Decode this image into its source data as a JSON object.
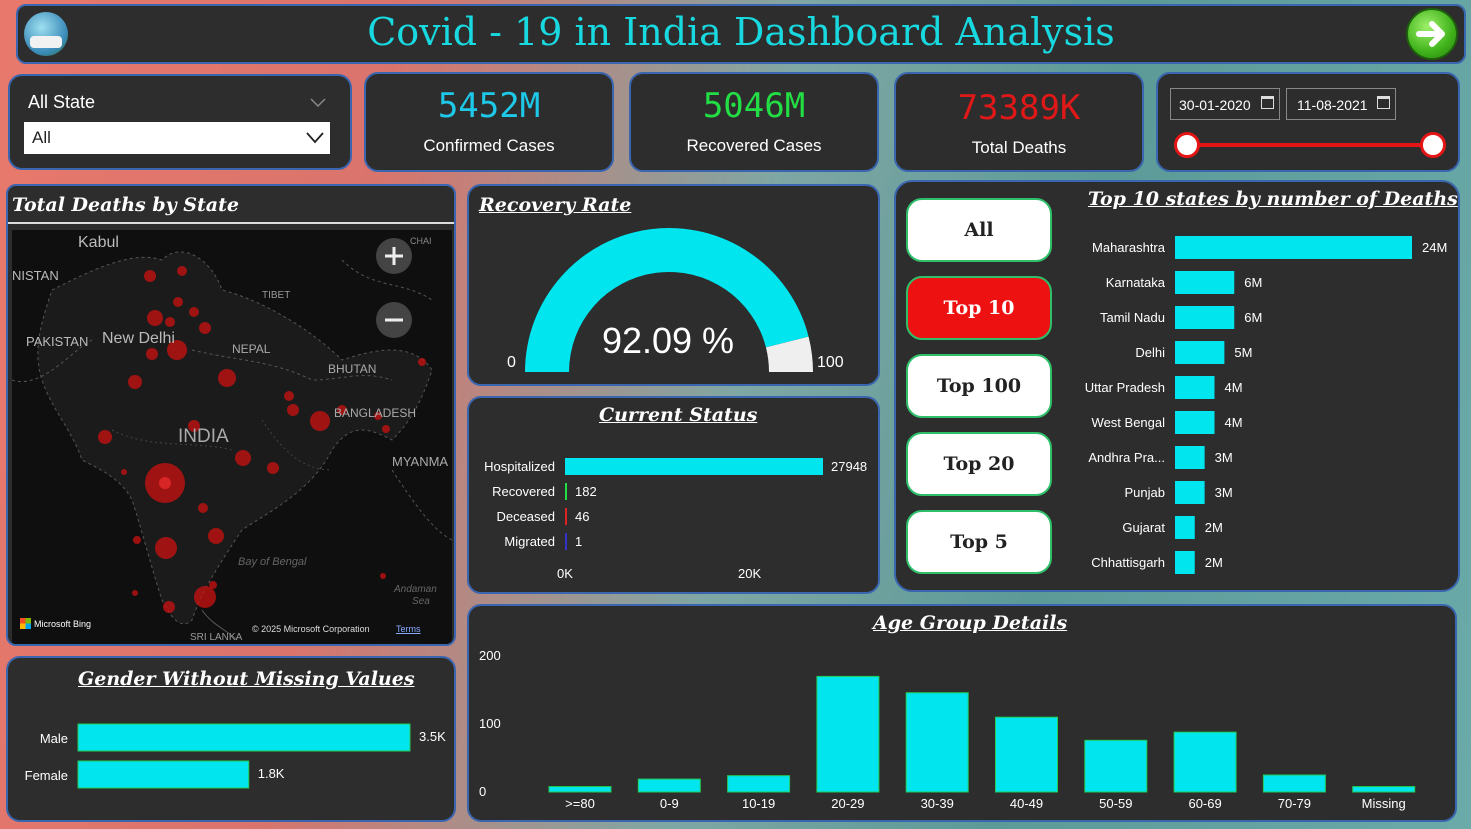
{
  "header": {
    "title": "Covid - 19 in India Dashboard Analysis"
  },
  "filter": {
    "label": "All State",
    "selected": "All"
  },
  "kpis": [
    {
      "value": "5452M",
      "label": "Confirmed Cases",
      "color": "#1ec8e8"
    },
    {
      "value": "5046M",
      "label": "Recovered Cases",
      "color": "#22dd44"
    },
    {
      "value": "73389K",
      "label": "Total Deaths",
      "color": "#e01818"
    }
  ],
  "dates": {
    "start": "30-01-2020",
    "end": "11-08-2021"
  },
  "map": {
    "title": "Total Deaths by State",
    "labels": {
      "kabul": "Kabul",
      "nistan": "NISTAN",
      "pakistan": "PAKISTAN",
      "newdelhi": "New Delhi",
      "tibet": "TIBET",
      "nepal": "NEPAL",
      "bhutan": "BHUTAN",
      "bangladesh": "BANGLADESH",
      "india": "INDIA",
      "myanmar": "MYANMA",
      "bay": "Bay of Bengal",
      "andaman": "Andaman",
      "sea": "Sea",
      "srilanka": "SRI LANKA",
      "chai": "CHAI"
    },
    "attribution": "© 2025 Microsoft Corporation",
    "terms": "Terms",
    "bing": "Microsoft Bing"
  },
  "recovery": {
    "title": "Recovery Rate",
    "value_text": "92.09 %",
    "value": 92.09,
    "min": "0",
    "max": "100",
    "color": "#00e5ee"
  },
  "status": {
    "title": "Current Status",
    "items": [
      {
        "label": "Hospitalized",
        "value": 27948,
        "value_text": "27948",
        "color": "#00e5ee"
      },
      {
        "label": "Recovered",
        "value": 182,
        "value_text": "182",
        "color": "#22dd44"
      },
      {
        "label": "Deceased",
        "value": 46,
        "value_text": "46",
        "color": "#dd2222"
      },
      {
        "label": "Migrated",
        "value": 1,
        "value_text": "1",
        "color": "#3333cc"
      }
    ],
    "ticks": [
      "0K",
      "20K"
    ]
  },
  "top_buttons": [
    "All",
    "Top 10",
    "Top 100",
    "Top 20",
    "Top 5"
  ],
  "top_active": "Top 10",
  "chart_data": [
    {
      "type": "bar",
      "title": "Top 10 states by number of Deaths",
      "orientation": "horizontal",
      "categories": [
        "Maharashtra",
        "Karnataka",
        "Tamil Nadu",
        "Delhi",
        "Uttar Pradesh",
        "West Bengal",
        "Andhra Pra...",
        "Punjab",
        "Gujarat",
        "Chhattisgarh"
      ],
      "values": [
        24,
        6,
        6,
        5,
        4,
        4,
        3,
        3,
        2,
        2
      ],
      "value_labels": [
        "24M",
        "6M",
        "6M",
        "5M",
        "4M",
        "4M",
        "3M",
        "3M",
        "2M",
        "2M"
      ]
    },
    {
      "type": "bar",
      "title": "Age Group Details",
      "categories": [
        ">=80",
        "0-9",
        "10-19",
        "20-29",
        "30-39",
        "40-49",
        "50-59",
        "60-69",
        "70-79",
        "Missing"
      ],
      "values": [
        8,
        19,
        24,
        170,
        146,
        110,
        76,
        88,
        25,
        8
      ],
      "ylim": [
        0,
        200
      ],
      "yticks": [
        "200",
        "100",
        "0"
      ]
    },
    {
      "type": "bar",
      "title": "Gender Without Missing Values",
      "orientation": "horizontal",
      "categories": [
        "Male",
        "Female"
      ],
      "values": [
        3.5,
        1.8
      ],
      "value_labels": [
        "3.5K",
        "1.8K"
      ]
    }
  ],
  "colors": {
    "bar": "#00e5ee",
    "panel": "#2d2d2d",
    "border": "#3a66b0",
    "title": "#19d9e0"
  }
}
